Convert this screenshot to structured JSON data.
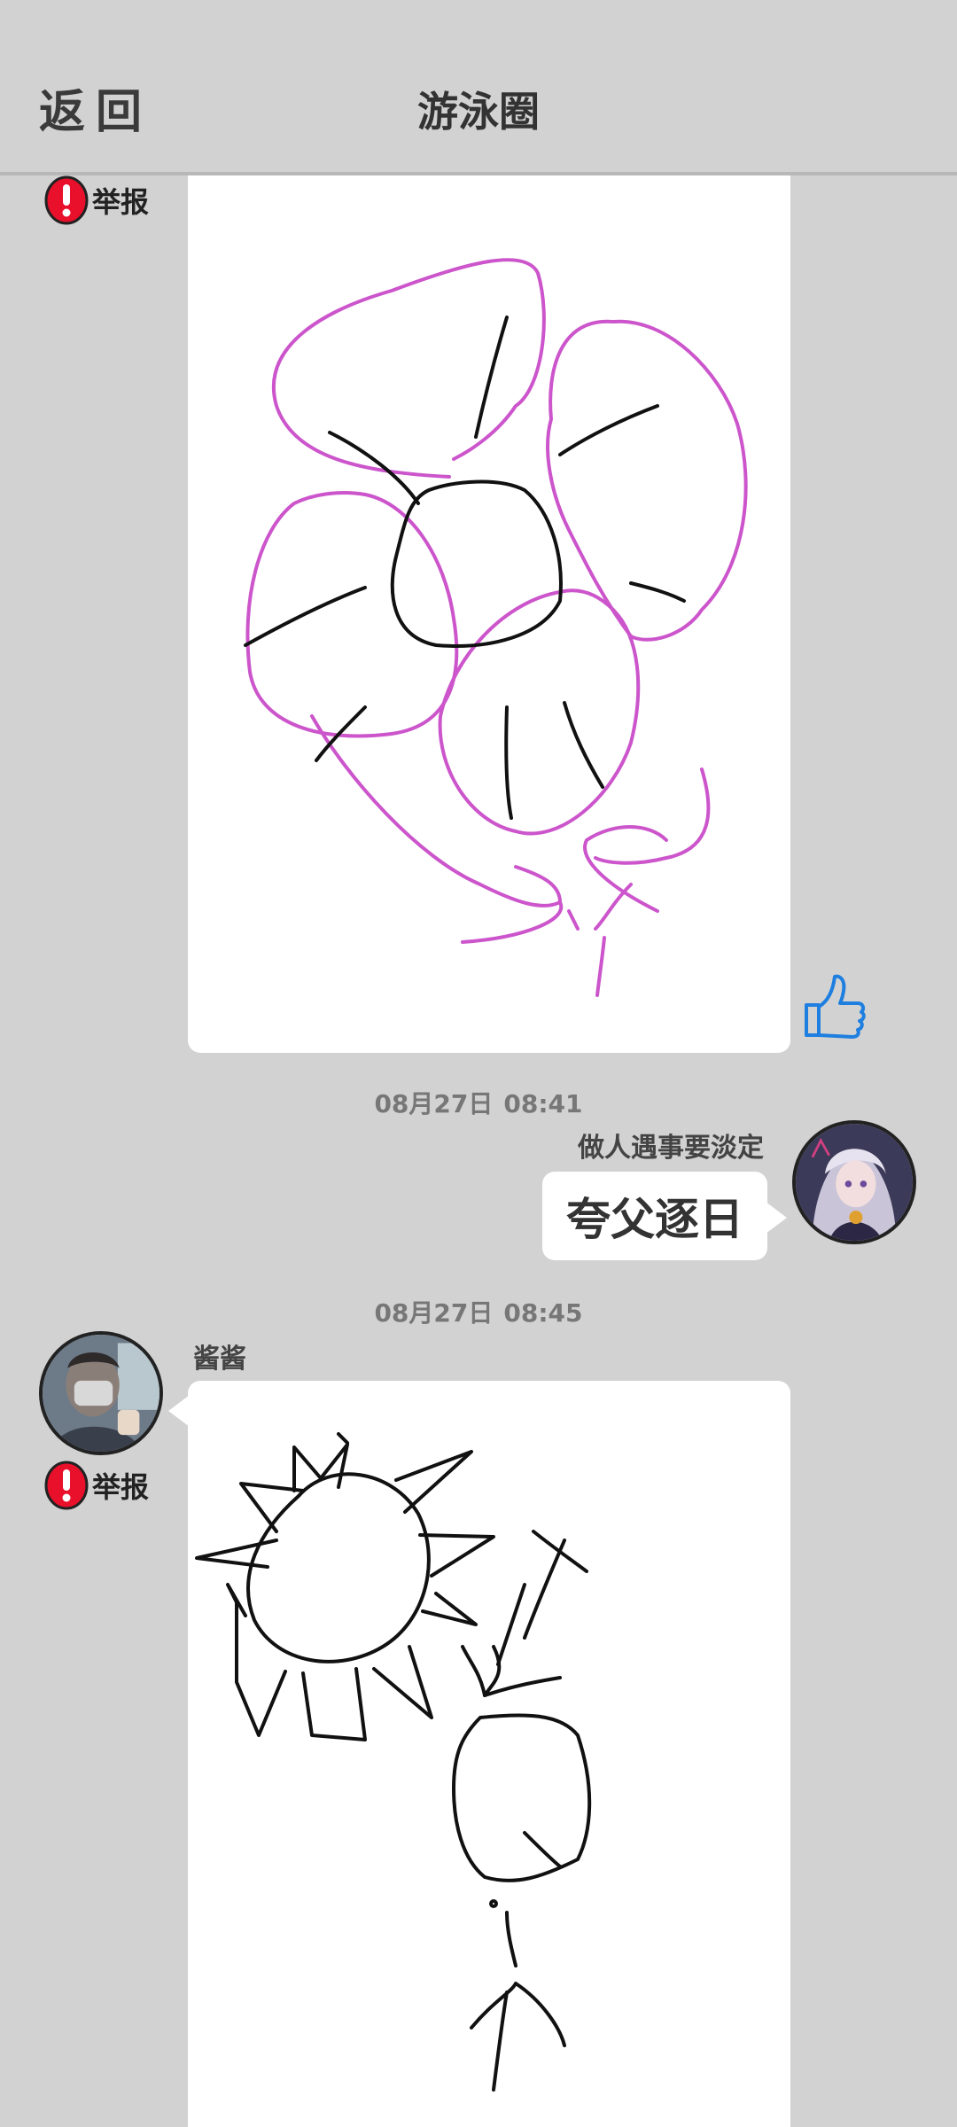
{
  "header": {
    "back_label": "返回",
    "title": "游泳圈"
  },
  "messages": [
    {
      "report_label": "举报",
      "like_icon": "thumbs-up-icon",
      "drawing": "flower-doodle",
      "stroke_colors": [
        "#cc55cc",
        "#111111"
      ]
    },
    {
      "time_date": "08月27日",
      "time_clock": "08:41",
      "username": "做人遇事要淡定",
      "text": "夸父逐日",
      "avatar": "anime-avatar"
    },
    {
      "time_date": "08月27日",
      "time_clock": "08:45",
      "username": "酱酱",
      "report_label": "举报",
      "avatar": "photo-avatar",
      "drawing": "sun-and-figure-doodle",
      "stroke_colors": [
        "#111111"
      ]
    }
  ],
  "colors": {
    "background": "#d2d2d2",
    "card": "#ffffff",
    "report_red": "#e8102a",
    "like_blue": "#1e7fe0"
  }
}
